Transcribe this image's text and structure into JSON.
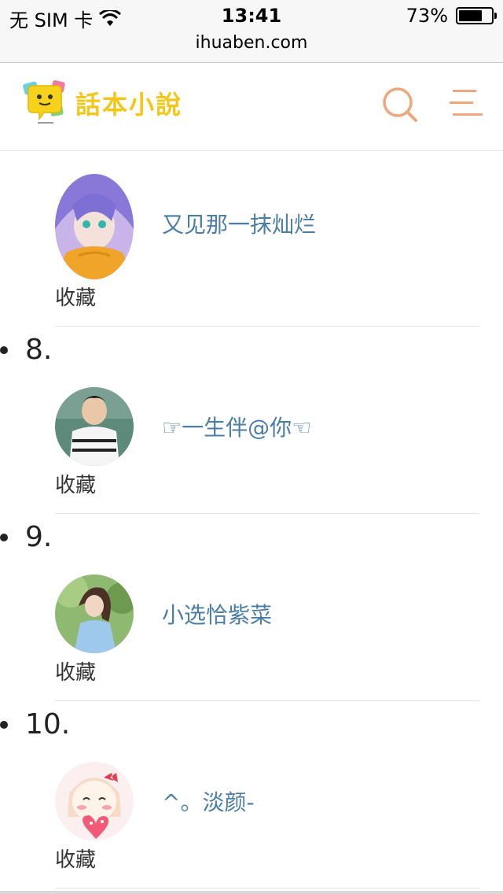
{
  "status_bar": {
    "carrier": "无 SIM 卡",
    "time": "13:41",
    "battery": "73%",
    "battery_level": 0.73
  },
  "url_bar": {
    "domain": "ihuaben.com"
  },
  "header": {
    "logo_text": "話本小說",
    "search_icon": "search-icon",
    "menu_icon": "menu-icon"
  },
  "list": {
    "fav_label": "收藏",
    "entries": [
      {
        "rank": "",
        "name": "又见那一抹灿烂"
      },
      {
        "rank": "8.",
        "name": "☞一生伴@你☜"
      },
      {
        "rank": "9.",
        "name": "小选恰紫菜"
      },
      {
        "rank": "10.",
        "name": "^。淡颜-"
      }
    ]
  },
  "colors": {
    "link": "#4a7da8",
    "accent": "#f0a070",
    "logo": "#f3c71a"
  }
}
